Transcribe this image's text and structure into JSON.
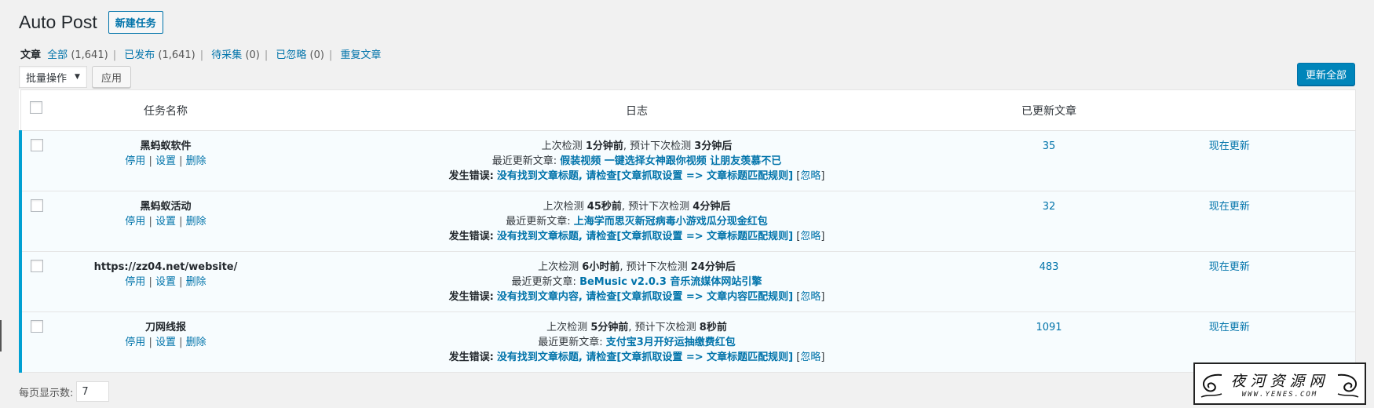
{
  "header": {
    "title": "Auto Post",
    "add_new": "新建任务"
  },
  "filters": {
    "label": "文章",
    "items": [
      {
        "label": "全部",
        "count": "(1,641)"
      },
      {
        "label": "已发布",
        "count": "(1,641)"
      },
      {
        "label": "待采集",
        "count": "(0)"
      },
      {
        "label": "已忽略",
        "count": "(0)"
      },
      {
        "label": "重复文章",
        "count": ""
      }
    ]
  },
  "bulk": {
    "select_value": "批量操作",
    "apply": "应用"
  },
  "update_all": "更新全部",
  "columns": {
    "name": "任务名称",
    "log": "日志",
    "updated": "已更新文章"
  },
  "row_actions": {
    "disable": "停用",
    "settings": "设置",
    "delete": "删除",
    "sep": "|"
  },
  "log_labels": {
    "last_check": "上次检测",
    "next_check": ", 预计下次检测",
    "latest": "最近更新文章:",
    "error": "发生错误:",
    "ignore": "忽略"
  },
  "update_now": "现在更新",
  "rows": [
    {
      "name": "黑蚂蚁软件",
      "last": "1分钟前",
      "next": "3分钟后",
      "latest": "假装视频 一键选择女神跟你视频 让朋友羡慕不已",
      "error": "没有找到文章标题, 请检查[文章抓取设置 => 文章标题匹配规则]",
      "count": "35"
    },
    {
      "name": "黑蚂蚁活动",
      "last": "45秒前",
      "next": "4分钟后",
      "latest": "上海学而思灭新冠病毒小游戏瓜分现金红包",
      "error": "没有找到文章标题, 请检查[文章抓取设置 => 文章标题匹配规则]",
      "count": "32"
    },
    {
      "name": "https://zz04.net/website/",
      "last": "6小时前",
      "next": "24分钟后",
      "latest": "BeMusic v2.0.3 音乐流媒体网站引擎",
      "error": "没有找到文章内容, 请检查[文章抓取设置 => 文章内容匹配规则]",
      "count": "483"
    },
    {
      "name": "刀网线报",
      "last": "5分钟前",
      "next": "8秒前",
      "latest": "支付宝3月开好运抽缴费红包",
      "error": "没有找到文章标题, 请检查[文章抓取设置 => 文章标题匹配规则]",
      "count": "1091"
    }
  ],
  "per_page": {
    "label": "每页显示数:",
    "value": "7"
  },
  "watermark": {
    "title": "夜河资源网",
    "url": "WWW.YENES.COM"
  }
}
